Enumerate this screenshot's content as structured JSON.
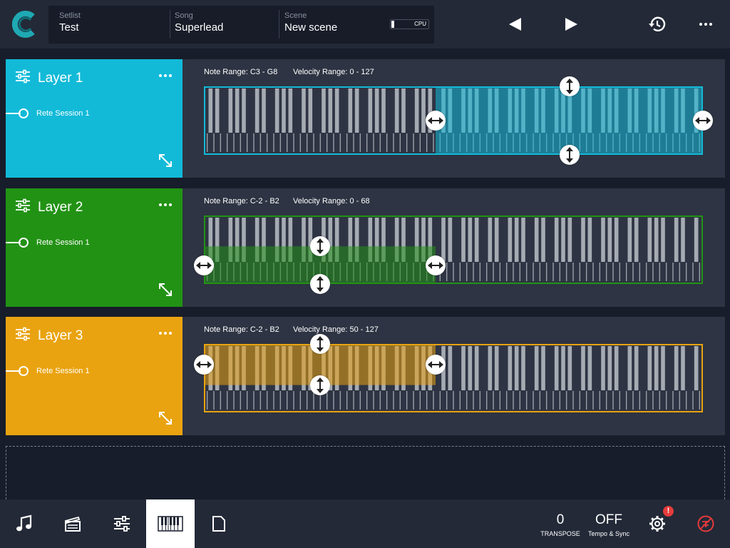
{
  "app": {
    "logo_icon": "app-logo-c",
    "accent": "#1fa9b3"
  },
  "header": {
    "setlist_label": "Setlist",
    "setlist_value": "Test",
    "song_label": "Song",
    "song_value": "Superlead",
    "scene_label": "Scene",
    "scene_value": "New scene",
    "cpu_label": "CPU",
    "cpu_level": 0.08,
    "prev_icon": "previous-icon",
    "next_icon": "next-icon",
    "history_icon": "history-icon",
    "more_icon": "more-icon"
  },
  "layers": [
    {
      "title": "Layer 1",
      "session": "Rete Session 1",
      "color": "#12bad8",
      "note_range": "Note Range: C3 - G8",
      "velocity_range": "Velocity Range: 0 - 127"
    },
    {
      "title": "Layer 2",
      "session": "Rete Session 1",
      "color": "#229215",
      "note_range": "Note Range: C-2 - B2",
      "velocity_range": "Velocity Range: 0 - 68"
    },
    {
      "title": "Layer 3",
      "session": "Rete Session 1",
      "color": "#e9a310",
      "note_range": "Note Range: C-2 - B2",
      "velocity_range": "Velocity Range: 50 - 127"
    }
  ],
  "footer": {
    "transpose_value": "0",
    "transpose_label": "TRANSPOSE",
    "tempo_value": "OFF",
    "tempo_label": "Tempo & Sync",
    "settings_badge": "!",
    "tabs": [
      "music-note-icon",
      "clapperboard-icon",
      "mixer-sliders-icon",
      "keyboard-icon",
      "document-icon"
    ],
    "active_tab": "keyboard-icon"
  }
}
